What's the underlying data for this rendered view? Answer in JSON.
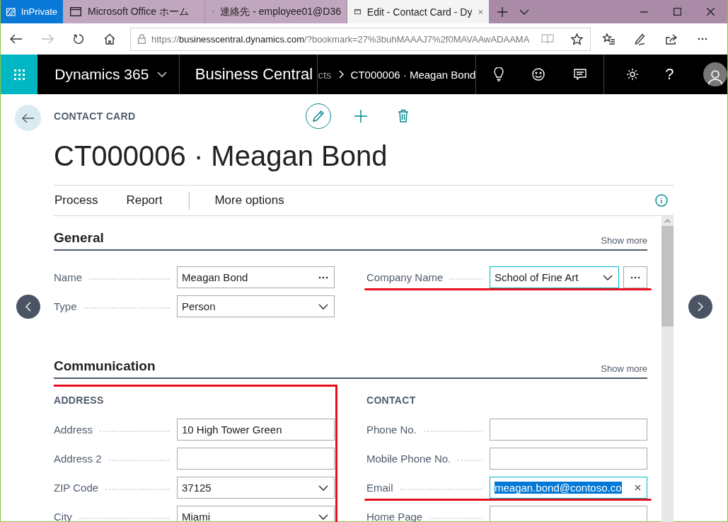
{
  "browser": {
    "private_badge": "InPrivate",
    "tabs": [
      {
        "label": "Microsoft Office ホーム",
        "selected": false
      },
      {
        "label": "連絡先 - employee01@D36",
        "selected": false
      },
      {
        "label": "Edit - Contact Card - Dy",
        "selected": true
      }
    ],
    "url": {
      "scheme": "https://",
      "host": "businesscentral.dynamics.com",
      "path": "/?bookmark=27%3buhMAAAJ7%2f0MAVAAwADAAMA"
    }
  },
  "app_bar": {
    "product": "Dynamics 365",
    "app": "Business Central",
    "breadcrumb": [
      "cts",
      "CT000006 · Meagan Bond"
    ],
    "help": "?"
  },
  "page": {
    "caption": "CONTACT CARD",
    "title": "CT000006 · Meagan Bond",
    "actions": [
      "Process",
      "Report",
      "More options"
    ]
  },
  "sections": [
    {
      "title": "General",
      "show_more": "Show more",
      "columns": [
        {
          "fields": [
            {
              "label": "Name",
              "kind": "lookup",
              "value": "Meagan Bond",
              "focused": false,
              "text_selected": false,
              "underlined": false
            },
            {
              "label": "Type",
              "kind": "dropdown",
              "value": "Person",
              "focused": false,
              "text_selected": false,
              "underlined": false
            }
          ]
        },
        {
          "fields": [
            {
              "label": "Company Name",
              "kind": "combo",
              "value": "School of Fine Art",
              "focused": true,
              "text_selected": false,
              "underlined": true
            }
          ]
        }
      ]
    },
    {
      "title": "Communication",
      "show_more": "Show more",
      "columns": [
        {
          "heading": "ADDRESS",
          "boxed": true,
          "fields": [
            {
              "label": "Address",
              "kind": "text",
              "value": "10 High Tower Green",
              "focused": false,
              "text_selected": false,
              "underlined": false
            },
            {
              "label": "Address 2",
              "kind": "text",
              "focused": false,
              "text_selected": false,
              "underlined": false
            },
            {
              "label": "ZIP Code",
              "kind": "dropdown",
              "value": "37125",
              "focused": false,
              "text_selected": false,
              "underlined": false
            },
            {
              "label": "City",
              "kind": "dropdown",
              "value": "Miami",
              "focused": false,
              "text_selected": false,
              "underlined": false
            }
          ]
        },
        {
          "heading": "CONTACT",
          "boxed": false,
          "fields": [
            {
              "label": "Phone No.",
              "kind": "text",
              "focused": false,
              "text_selected": false,
              "underlined": false
            },
            {
              "label": "Mobile Phone No.",
              "kind": "text",
              "focused": false,
              "text_selected": false,
              "underlined": false
            },
            {
              "label": "Email",
              "kind": "text",
              "value": "meagan.bond@contoso.co",
              "focused": true,
              "text_selected": true,
              "underlined": true
            },
            {
              "label": "Home Page",
              "kind": "text",
              "focused": false,
              "text_selected": false,
              "underlined": false
            }
          ]
        }
      ]
    }
  ]
}
